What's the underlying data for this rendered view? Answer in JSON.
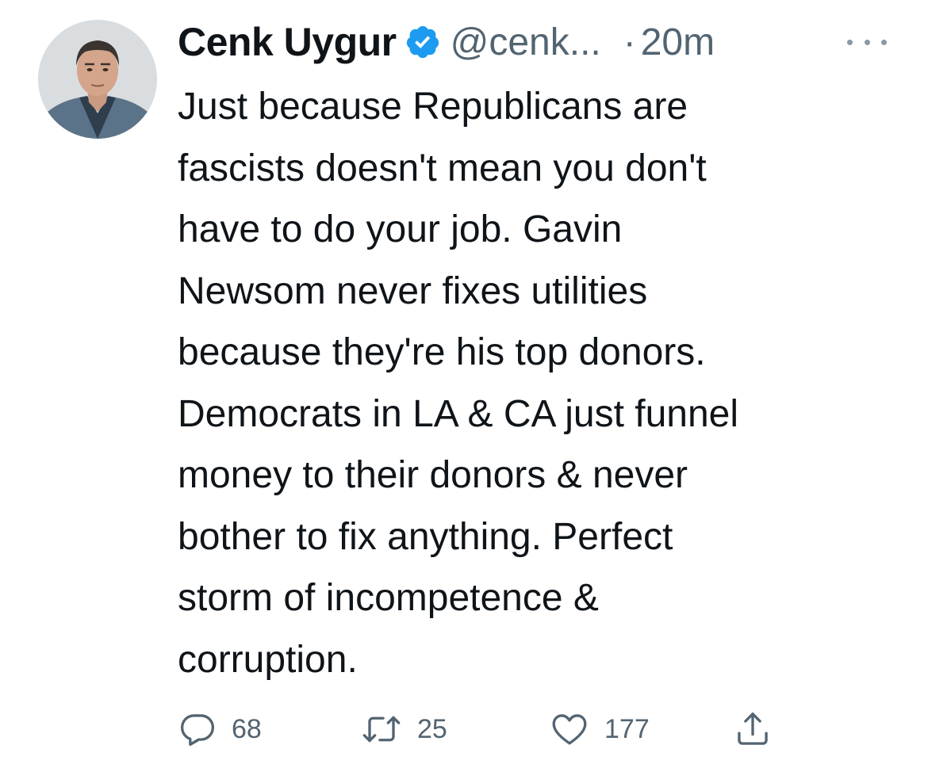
{
  "author": {
    "display_name": "Cenk Uygur",
    "handle": "@cenk...",
    "separator": "·",
    "time": "20m",
    "verified": true
  },
  "tweet": {
    "lines": [
      "Just because Republicans are",
      "fascists doesn't mean you don't",
      "have to do your job. Gavin",
      "Newsom never fixes utilities",
      "because they're his top donors.",
      "Democrats in LA & CA just funnel",
      "money to their donors & never",
      "bother to fix anything. Perfect",
      "storm of incompetence &",
      "corruption."
    ]
  },
  "actions": {
    "replies": "68",
    "retweets": "25",
    "likes": "177"
  },
  "icons": {
    "verified": "verified-badge-icon",
    "more": "more-icon",
    "reply": "reply-icon",
    "retweet": "retweet-icon",
    "like": "heart-icon",
    "share": "share-icon"
  },
  "colors": {
    "text": "#0f1419",
    "secondary": "#536471",
    "verified": "#1d9bf0"
  }
}
